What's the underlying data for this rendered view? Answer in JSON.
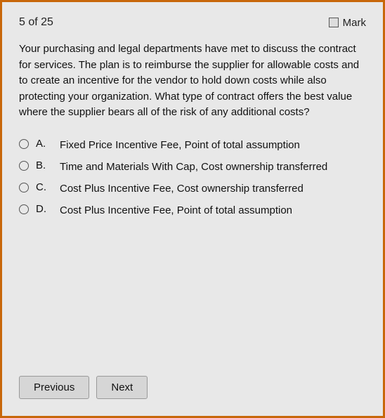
{
  "header": {
    "counter": "5 of 25",
    "mark_label": "Mark"
  },
  "question": {
    "text": "Your purchasing and legal departments have met to discuss the contract for services. The plan is to reimburse the supplier for allowable costs and to create an incentive for the vendor to hold down costs while also protecting your organization. What type of contract offers the best value where the supplier bears all of the risk of any additional costs?"
  },
  "options": [
    {
      "letter": "A.",
      "text": "Fixed Price Incentive Fee, Point of total assumption"
    },
    {
      "letter": "B.",
      "text": "Time and Materials With Cap, Cost ownership transferred"
    },
    {
      "letter": "C.",
      "text": "Cost Plus Incentive Fee, Cost ownership transferred"
    },
    {
      "letter": "D.",
      "text": "Cost Plus Incentive Fee, Point of total assumption"
    }
  ],
  "footer": {
    "previous_label": "Previous",
    "next_label": "Next"
  }
}
